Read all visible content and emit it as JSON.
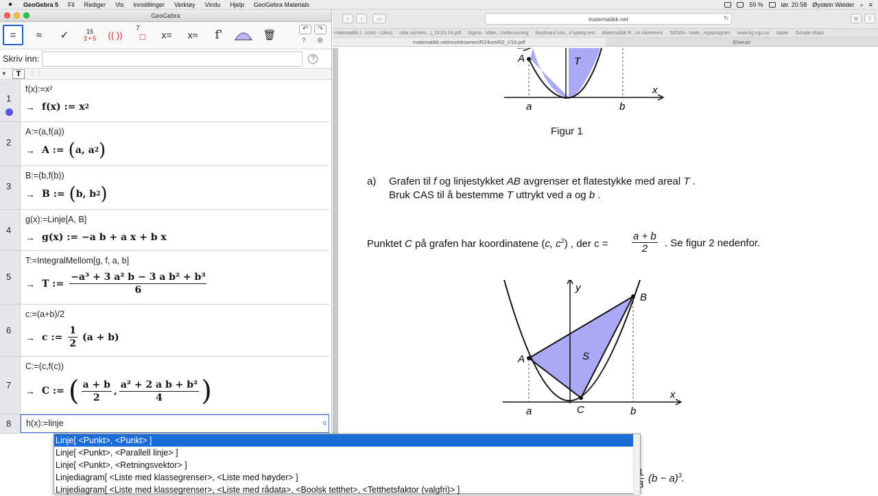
{
  "menubar": {
    "app": "GeoGebra 5",
    "items": [
      "Fil",
      "Rediger",
      "Vis",
      "Innstillinger",
      "Verktøy",
      "Vindu",
      "Hjelp",
      "GeoGebra Materials"
    ],
    "battery": "59 %",
    "clock": "lør. 20.58",
    "user": "Øystein Weider"
  },
  "geogebra": {
    "title": "GeoGebra",
    "toolbar": {
      "t_eval": "=",
      "t_approx": "≈",
      "t_check": "✓",
      "t_factor_top": "15",
      "t_factor_bottom": "3 • 5",
      "t_expand": "(( ))",
      "t_subst": "7",
      "t_solve": "x=",
      "t_nsolve": "x≈",
      "t_deriv": "f'",
      "t_integral": "∫",
      "t_delete": "🗑",
      "undo": "↶",
      "redo": "↷",
      "help_icon": "?",
      "settings_icon": "⚙"
    },
    "input_label": "Skriv inn:",
    "input_value": "",
    "input_help": "?",
    "style_bar": {
      "text_btn": "T",
      "grid_btn": "⋮⋮",
      "toggle": "▼"
    },
    "rows": [
      {
        "n": "1",
        "input": "f(x):=x²",
        "out_prefix": "f(x)  :=  x",
        "out_sup": "2"
      },
      {
        "n": "2",
        "input": "A:=(a,f(a))",
        "out_prefix": "A  :=",
        "out_body": "a, a",
        "out_sup": "2"
      },
      {
        "n": "3",
        "input": "B:=(b,f(b))",
        "out_prefix": "B  :=",
        "out_body": "b, b",
        "out_sup": "2"
      },
      {
        "n": "4",
        "input": "g(x):=Linje[A, B]",
        "out_text": "g(x)  :=  −a b + a x + b x"
      },
      {
        "n": "5",
        "input": "T:=IntegralMellom[g, f, a, b]",
        "out_prefix": "T  :=",
        "num_text": "−a³ + 3 a² b − 3 a b² + b³",
        "den_text": "6"
      },
      {
        "n": "6",
        "input": "c:=(a+b)/2",
        "out_prefix": "c  :=",
        "num_text": "1",
        "den_text": "2",
        "out_suffix": "(a + b)"
      },
      {
        "n": "7",
        "input": "C:=(c,f(c))",
        "out_prefix": "C  :=",
        "f1_num": "a + b",
        "f1_den": "2",
        "f2_num": "a² + 2 a b + b²",
        "f2_den": "4"
      },
      {
        "n": "8",
        "input": "h(x):=linje"
      }
    ],
    "arrow": "→",
    "cell_badge": "α",
    "autocomplete": [
      "Linje[ <Punkt>, <Punkt> ]",
      "Linje[ <Punkt>, <Parallell linje> ]",
      "Linje[ <Punkt>, <Retningsvektor> ]",
      "Linjediagram[ <Liste med klassegrenser>, <Liste med høyder> ]",
      "Linjediagram[ <Liste med klassegrenser>, <Liste med rådata>, <Boolsk tetthet>, <Tetthetsfaktor (valgfri)> ]"
    ]
  },
  "browser": {
    "url": "matematikk.net",
    "bookmarks": [
      "matematikk.l...nsed - Lokus",
      "ndla.no/sites...|_24.03.14.pdf",
      "Sigma - Mate...Undervisning",
      "Keyboard tuto...d typing test",
      "Matematikk R...us inkrement",
      "SIGMA - mate...ingsprogram",
      "www.kg.vgs.no",
      "Apple",
      "Google Maps"
    ],
    "tabs": [
      "matematikk.net/res/eksamen/R2/kort/R2_V16.pdf",
      "Elvenar"
    ],
    "doc": {
      "fig1_caption": "Figur 1",
      "fig1_labels": {
        "A": "A",
        "T": "T",
        "x": "x",
        "a": "a",
        "b": "b"
      },
      "part_a_label": "a)",
      "part_a_line1_1": "Grafen til ",
      "part_a_line1_f": "f",
      "part_a_line1_2": "  og linjestykket ",
      "part_a_line1_AB": "AB",
      "part_a_line1_3": "  avgrenser et flatestykke med areal ",
      "part_a_line1_T": "T",
      "part_a_line1_4": " .",
      "part_a_line2_1": "Bruk CAS til å bestemme ",
      "part_a_line2_T": "T",
      "part_a_line2_2": "  uttrykt ved ",
      "part_a_line2_a": "a",
      "part_a_line2_3": "  og ",
      "part_a_line2_b": "b",
      "part_a_line2_4": " .",
      "pointC_text1": "Punktet ",
      "pointC_C": "C",
      "pointC_text2": "  på grafen har koordinatene  (",
      "pointC_coords": "c, c",
      "pointC_sup": "2",
      "pointC_text3": ") , der   c =",
      "pointC_num": "a + b",
      "pointC_den": "2",
      "pointC_text4": ".  Se figur 2 nedenfor.",
      "fig2_labels": {
        "y": "y",
        "B": "B",
        "A": "A",
        "S": "S",
        "x": "x",
        "a": "a",
        "C": "C",
        "b": "b"
      },
      "bottom_partial_num": "1",
      "bottom_partial_den": "3",
      "bottom_partial_text": "(b − a)",
      "bottom_partial_sup": "3",
      "bottom_partial_dot": "."
    }
  },
  "colors": {
    "fill": "#a9a9f5",
    "accent": "#1a6dd6",
    "green": "#18801e"
  }
}
